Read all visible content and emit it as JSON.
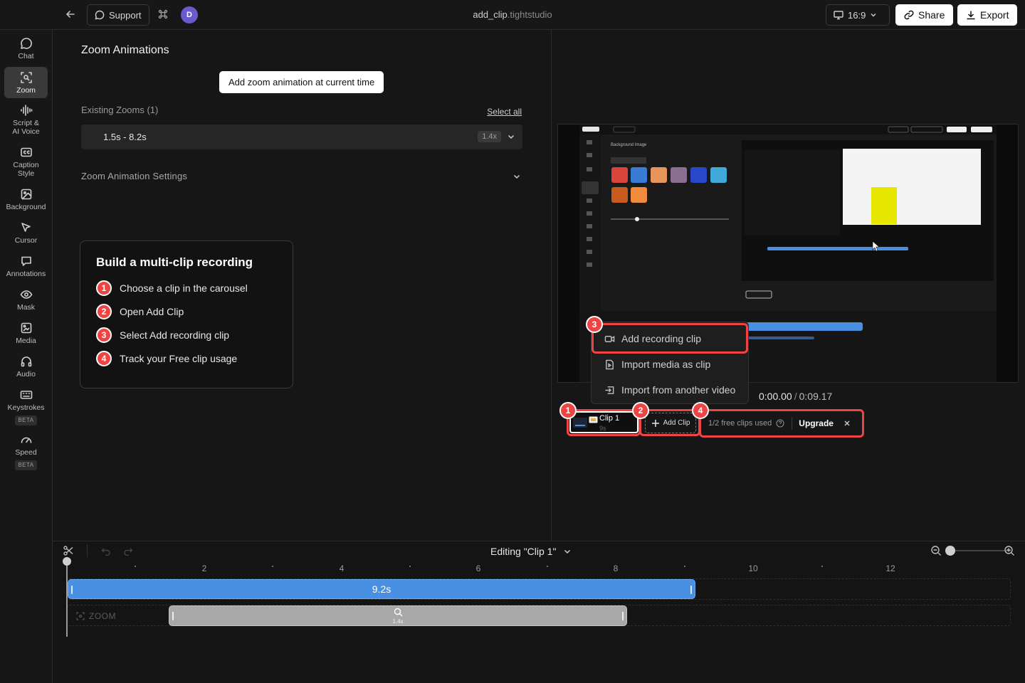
{
  "topbar": {
    "support_label": "Support",
    "avatar_initial": "D",
    "file_name": "add_clip",
    "file_ext": ".tightstudio",
    "aspect_label": "16:9",
    "share_label": "Share",
    "export_label": "Export"
  },
  "sidebar": {
    "items": [
      {
        "label": "Chat",
        "icon": "chat-icon"
      },
      {
        "label": "Zoom",
        "icon": "zoom-icon",
        "active": true
      },
      {
        "label": "Script &\nAI Voice",
        "icon": "waveform-icon"
      },
      {
        "label": "Caption\nStyle",
        "icon": "caption-icon"
      },
      {
        "label": "Background",
        "icon": "image-icon"
      },
      {
        "label": "Cursor",
        "icon": "cursor-icon"
      },
      {
        "label": "Annotations",
        "icon": "annotation-icon"
      },
      {
        "label": "Mask",
        "icon": "eye-icon"
      },
      {
        "label": "Media",
        "icon": "media-icon"
      },
      {
        "label": "Audio",
        "icon": "headphones-icon"
      },
      {
        "label": "Keystrokes",
        "icon": "keyboard-icon",
        "badge": "BETA"
      },
      {
        "label": "Speed",
        "icon": "speed-icon",
        "badge": "BETA"
      }
    ]
  },
  "panel": {
    "title": "Zoom Animations",
    "add_button": "Add zoom animation at current time",
    "existing_label": "Existing Zooms (1)",
    "select_all": "Select all",
    "zooms": [
      {
        "range": "1.5s - 8.2s",
        "scale": "1.4x"
      }
    ],
    "settings_label": "Zoom Animation Settings"
  },
  "tutorial": {
    "title": "Build a multi-clip recording",
    "steps": [
      {
        "num": "1",
        "text": "Choose a clip in the carousel"
      },
      {
        "num": "2",
        "text": "Open Add Clip"
      },
      {
        "num": "3",
        "text": "Select Add recording clip"
      },
      {
        "num": "4",
        "text": "Track your Free clip usage"
      }
    ]
  },
  "preview": {
    "current_time": "0:00.00",
    "separator": "/",
    "total_time": "0:09.17"
  },
  "clip_menu": {
    "items": [
      {
        "label": "Add recording clip",
        "icon": "video-camera-icon"
      },
      {
        "label": "Import media as clip",
        "icon": "file-play-icon"
      },
      {
        "label": "Import from another video",
        "icon": "import-icon"
      }
    ]
  },
  "carousel": {
    "clip_name": "Clip 1",
    "clip_duration": "9s",
    "add_clip_label": "Add Clip",
    "free_usage": "1/2 free clips used",
    "upgrade_label": "Upgrade",
    "badges": [
      "1",
      "2",
      "3",
      "4"
    ]
  },
  "timeline": {
    "title": "Editing \"Clip 1\"",
    "ticks": [
      "2",
      "4",
      "6",
      "8",
      "10",
      "12"
    ],
    "clip_bar_label": "9.2s",
    "zoom_track_label": "ZOOM",
    "zoom_bar_scale": "1.4x"
  },
  "colors": {
    "accent_blue": "#4a90e2",
    "badge_red": "#ef4444",
    "background": "#161616"
  }
}
